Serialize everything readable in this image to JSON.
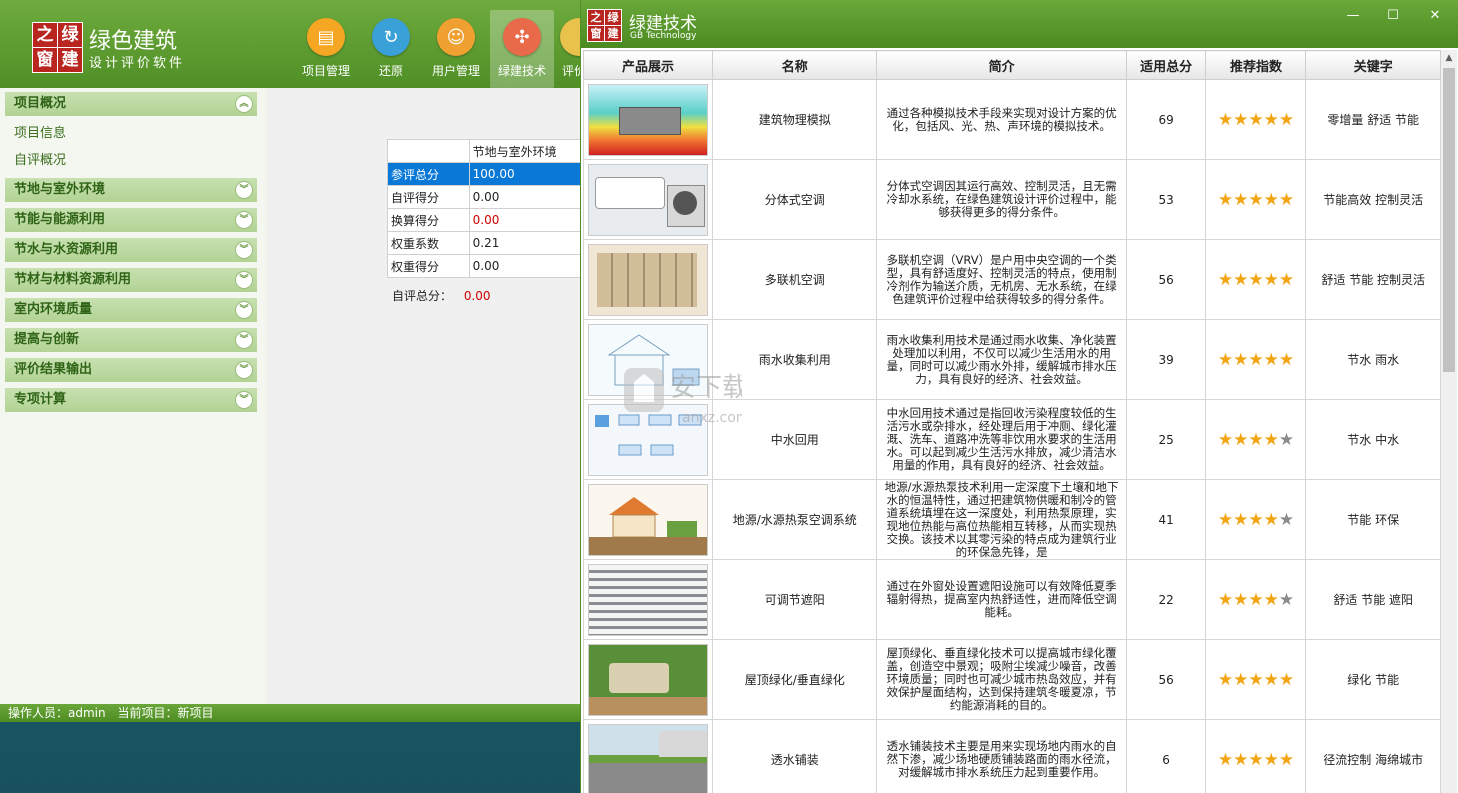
{
  "app": {
    "logo_chars": [
      "之",
      "绿",
      "窗",
      "建"
    ],
    "title": "绿色建筑",
    "subtitle": "设计评价软件"
  },
  "toolbar": [
    {
      "label": "项目管理",
      "icon": "project-icon",
      "color": "#f5a623"
    },
    {
      "label": "还原",
      "icon": "restore-icon",
      "color": "#3aa0d8"
    },
    {
      "label": "用户管理",
      "icon": "user-icon",
      "color": "#f0a030"
    },
    {
      "label": "绿建技术",
      "icon": "tech-icon",
      "color": "#e86a4a"
    },
    {
      "label": "评价",
      "icon": "evaluate-icon",
      "color": "#e8c24a"
    }
  ],
  "sidebar": {
    "groups": [
      {
        "label": "项目概况",
        "expanded": true,
        "items": [
          "项目信息",
          "自评概况"
        ]
      },
      {
        "label": "节地与室外环境"
      },
      {
        "label": "节能与能源利用"
      },
      {
        "label": "节水与水资源利用"
      },
      {
        "label": "节材与材料资源利用"
      },
      {
        "label": "室内环境质量"
      },
      {
        "label": "提高与创新"
      },
      {
        "label": "评价结果输出"
      },
      {
        "label": "专项计算"
      }
    ]
  },
  "score_table": {
    "column_header": "节地与室外环境",
    "rows": [
      {
        "label": "参评总分",
        "value": "100.00",
        "selected": true
      },
      {
        "label": "自评得分",
        "value": "0.00"
      },
      {
        "label": "换算得分",
        "value": "0.00",
        "red": true
      },
      {
        "label": "权重系数",
        "value": "0.21"
      },
      {
        "label": "权重得分",
        "value": "0.00"
      }
    ],
    "self_total_label": "自评总分：",
    "self_total_value": "0.00"
  },
  "status": {
    "operator_label": "操作人员：",
    "operator": "admin",
    "project_label": "当前项目：",
    "project": "新项目"
  },
  "dialog": {
    "logo_chars": [
      "之",
      "绿",
      "窗",
      "建"
    ],
    "title": "绿建技术",
    "subtitle": "GB Technology",
    "controls": {
      "minimize": "—",
      "maximize": "☐",
      "close": "✕"
    },
    "columns": [
      "产品展示",
      "名称",
      "简介",
      "适用总分",
      "推荐指数",
      "关键字"
    ],
    "rows": [
      {
        "name": "建筑物理模拟",
        "desc": "通过各种模拟技术手段来实现对设计方案的优化，包括风、光、热、声环境的模拟技术。",
        "score": "69",
        "stars": 5,
        "keywords": "零增量  舒适  节能",
        "thumb": "simulation"
      },
      {
        "name": "分体式空调",
        "desc": "分体式空调因其运行高效、控制灵活，且无需冷却水系统，在绿色建筑设计评价过程中，能够获得更多的得分条件。",
        "score": "53",
        "stars": 5,
        "keywords": "节能高效  控制灵活",
        "thumb": "aircon"
      },
      {
        "name": "多联机空调",
        "desc": "多联机空调（VRV）是户用中央空调的一个类型，具有舒适度好、控制灵活的特点，使用制冷剂作为输送介质，无机房、无水系统，在绿色建筑评价过程中给获得较多的得分条件。",
        "score": "56",
        "stars": 5,
        "keywords": "舒适 节能 控制灵活",
        "thumb": "vrv"
      },
      {
        "name": "雨水收集利用",
        "desc": "雨水收集利用技术是通过雨水收集、净化装置处理加以利用，不仅可以减少生活用水的用量，同时可以减少雨水外排，缓解城市排水压力，具有良好的经济、社会效益。",
        "score": "39",
        "stars": 5,
        "keywords": "节水 雨水",
        "thumb": "rain"
      },
      {
        "name": "中水回用",
        "desc": "中水回用技术通过是指回收污染程度较低的生活污水或杂排水，经处理后用于冲厕、绿化灌溉、洗车、道路冲洗等非饮用水要求的生活用水。可以起到减少生活污水排放，减少清洁水用量的作用，具有良好的经济、社会效益。",
        "score": "25",
        "stars": 4,
        "keywords": "节水 中水",
        "thumb": "reclaim"
      },
      {
        "name": "地源/水源热泵空调系统",
        "desc": "地源/水源热泵技术利用一定深度下土壤和地下水的恒温特性，通过把建筑物供暖和制冷的管道系统填埋在这一深度处，利用热泵原理，实现地位热能与高位热能相互转移，从而实现热交换。该技术以其零污染的特点成为建筑行业的环保急先锋，是",
        "score": "41",
        "stars": 4,
        "keywords": "节能 环保",
        "thumb": "heatpump"
      },
      {
        "name": "可调节遮阳",
        "desc": "通过在外窗处设置遮阳设施可以有效降低夏季辐射得热，提高室内热舒适性，进而降低空调能耗。",
        "score": "22",
        "stars": 4,
        "keywords": "舒适 节能 遮阳",
        "thumb": "shade"
      },
      {
        "name": "屋顶绿化/垂直绿化",
        "desc": "屋顶绿化、垂直绿化技术可以提高城市绿化覆盖，创造空中景观；吸附尘埃减少噪音，改善环境质量；同时也可减少城市热岛效应，并有效保护屋面结构，达到保持建筑冬暖夏凉，节约能源消耗的目的。",
        "score": "56",
        "stars": 5,
        "keywords": "绿化 节能",
        "thumb": "roof"
      },
      {
        "name": "透水铺装",
        "desc": "透水铺装技术主要是用来实现场地内雨水的自然下渗，减少场地硬质铺装路面的雨水径流，对缓解城市排水系统压力起到重要作用。",
        "score": "6",
        "stars": 5,
        "keywords": "径流控制 海绵城市",
        "thumb": "paving"
      }
    ]
  },
  "watermark": {
    "text": "安下载",
    "sub": "anxz.com"
  },
  "colors": {
    "brand_green": "#4f8f25",
    "star": "#f3a412",
    "selection": "#0a78d7",
    "red_value": "#d00000"
  }
}
